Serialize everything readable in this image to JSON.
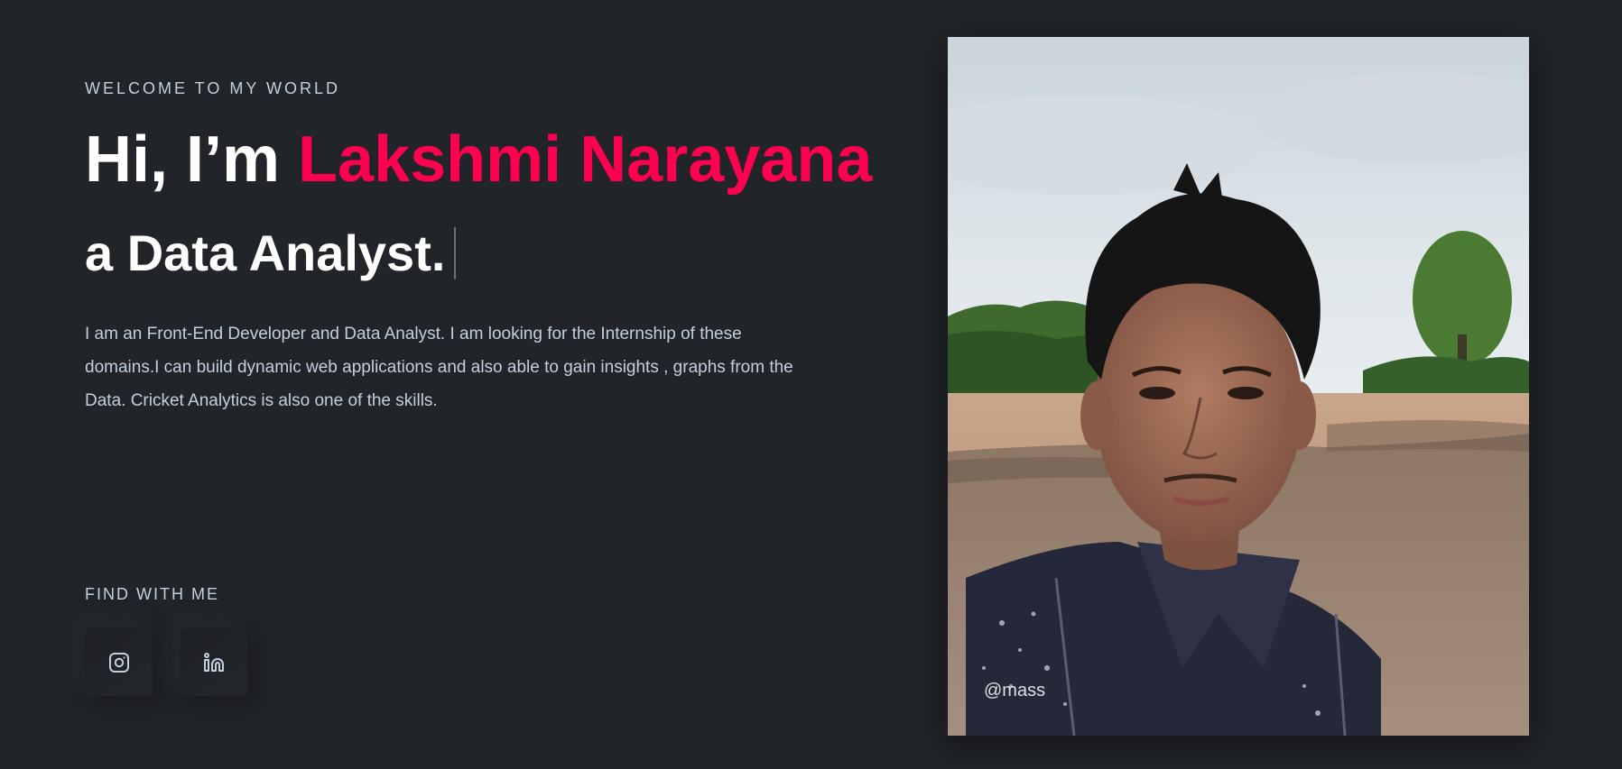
{
  "hero": {
    "eyebrow": "WELCOME TO MY WORLD",
    "greeting": "Hi, I’m ",
    "name": "Lakshmi Narayana",
    "role": "a Data Analyst.",
    "description": "I am an Front-End Developer and Data Analyst. I am looking for the Internship of these domains.I can build dynamic web applications and also able to gain insights , graphs from the Data. Cricket Analytics is also one of the skills."
  },
  "social": {
    "heading": "FIND WITH ME",
    "links": [
      {
        "icon": "instagram-icon"
      },
      {
        "icon": "linkedin-icon"
      }
    ]
  },
  "portrait": {
    "watermark": "@mass"
  },
  "colors": {
    "background": "#212428",
    "accent": "#ff014f",
    "text_muted": "#c4cfde",
    "text_primary": "#ffffff"
  }
}
